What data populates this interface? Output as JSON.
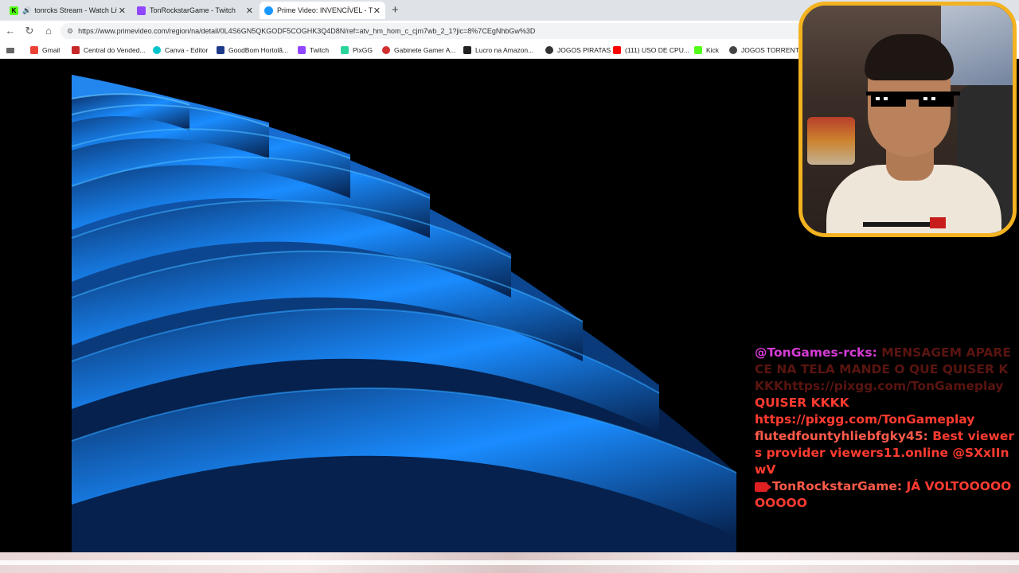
{
  "tabs": [
    {
      "title": "tonrcks Stream - Watch Live o",
      "favicon_color": "#53fc18",
      "favicon_glyph": "K",
      "audio": true
    },
    {
      "title": "TonRockstarGame - Twitch",
      "favicon_color": "#9146ff",
      "favicon_glyph": ""
    },
    {
      "title": "Prime Video: INVENCÍVEL - TEMPO",
      "favicon_color": "#1a98ff",
      "favicon_glyph": "",
      "active": true
    }
  ],
  "newtab_glyph": "+",
  "toolbar": {
    "url": "https://www.primevideo.com/region/na/detail/0L4S6GN5QKGODF5COGHK3Q4D8N/ref=atv_hm_hom_c_cjm7wb_2_1?jic=8%7CEgNhbGw%3D"
  },
  "bookmarks": [
    {
      "label": "Gmail",
      "icon_color": "#ea4335"
    },
    {
      "label": "Central do Vended...",
      "icon_color": "#c62828"
    },
    {
      "label": "Canva - Editor",
      "icon_color": "#00c4cc"
    },
    {
      "label": "GoodBom Hortolã...",
      "icon_color": "#1e3a8a"
    },
    {
      "label": "Twitch",
      "icon_color": "#9146ff"
    },
    {
      "label": "PixGG",
      "icon_color": "#2bd49a"
    },
    {
      "label": "Gabinete Gamer A...",
      "icon_color": "#d32f2f"
    },
    {
      "label": "Lucro na Amazon...",
      "icon_color": "#222222"
    },
    {
      "label": "JOGOS PIRATAS",
      "icon_color": "#333333"
    },
    {
      "label": "(111) USO DE CPU...",
      "icon_color": "#ff0000"
    },
    {
      "label": "Kick",
      "icon_color": "#53fc18"
    },
    {
      "label": "JOGOS TORRENT",
      "icon_color": "#444444"
    }
  ],
  "chat": {
    "messages": [
      {
        "user": "@TonGames-rcks:",
        "text": "MENSAGEM APARECE NA TELA MANDE O QUE QUISER KKKKhttps://pixgg.com/TonGameplay",
        "faded": true
      },
      {
        "user": "",
        "text": "QUISER KKKK",
        "faded": false
      },
      {
        "user": "",
        "text": "https://pixgg.com/TonGameplay",
        "faded": false
      },
      {
        "user": "flutedfountyhliebfgky45:",
        "text": "Best viewers provider viewers11.online @SXxIInwV",
        "faded": false
      },
      {
        "user": "TonRockstarGame:",
        "text": "JÁ VOLTOOOOOOOOOO",
        "faded": false
      }
    ]
  },
  "colors": {
    "webcam_border": "#f3b21f",
    "wave_blue": "#1a8cff",
    "chat_red": "#ff3b30",
    "chat_pink": "#d63bd6"
  }
}
